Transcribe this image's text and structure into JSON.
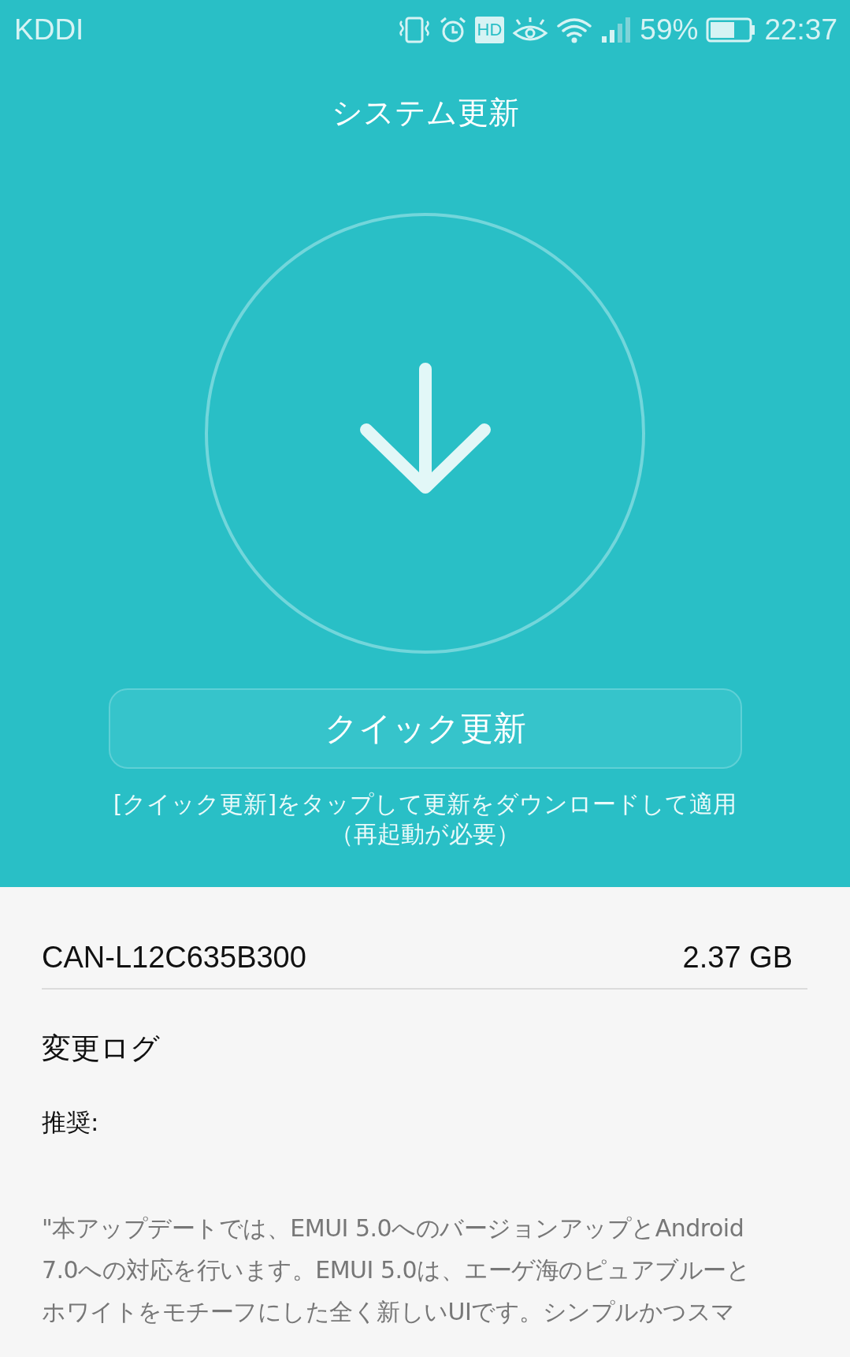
{
  "status_bar": {
    "carrier": "KDDI",
    "hd_badge": "HD",
    "battery": "59%",
    "time": "22:37"
  },
  "title": "システム更新",
  "quick_update_button": "クイック更新",
  "hint_lines": [
    "[クイック更新]をタップして更新をダウンロードして適用",
    "（再起動が必要）"
  ],
  "package": {
    "version": "CAN-L12C635B300",
    "size": "2.37 GB"
  },
  "changelog": {
    "heading": "変更ログ",
    "label": "推奨:",
    "lines": [
      "\"本アップデートでは、EMUI 5.0へのバージョンアップとAndroid",
      "7.0への対応を行います。EMUI 5.0は、エーゲ海のピュアブルーと",
      "ホワイトをモチーフにした全く新しいUIです。シンプルかつスマ"
    ]
  }
}
